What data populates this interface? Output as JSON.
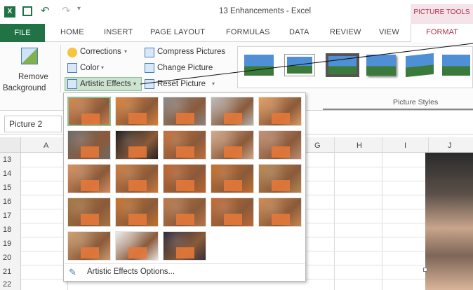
{
  "titlebar": {
    "title": "13 Enhancements - Excel",
    "context_group": "PICTURE TOOLS"
  },
  "tabs": {
    "file": "FILE",
    "items": [
      "HOME",
      "INSERT",
      "PAGE LAYOUT",
      "FORMULAS",
      "DATA",
      "REVIEW",
      "VIEW"
    ],
    "active": "FORMAT"
  },
  "ribbon": {
    "remove_background": [
      "Remove",
      "Background"
    ],
    "corrections": "Corrections",
    "color": "Color",
    "artistic_effects": "Artistic Effects",
    "compress_pictures": "Compress Pictures",
    "change_picture": "Change Picture",
    "reset_picture": "Reset Picture",
    "picture_styles_group": "Picture Styles"
  },
  "namebox": {
    "value": "Picture 2"
  },
  "columns": [
    "A",
    "G",
    "H",
    "I",
    "J"
  ],
  "rows": [
    "13",
    "14",
    "15",
    "16",
    "17",
    "18",
    "19",
    "20",
    "21",
    "22"
  ],
  "gallery": {
    "options_label": "Artistic Effects Options...",
    "rows": 5,
    "thumb_colors": [
      "#d8884e",
      "#e0843a",
      "#8a8a8a",
      "#bdbdbd",
      "#e7a060",
      "#6a6a6a",
      "#1c1c1c",
      "#c6713b",
      "#d6ab8c",
      "#c39276",
      "#d99260",
      "#cf7c3c",
      "#c2642e",
      "#c9702e",
      "#b98b52",
      "#a87740",
      "#c8742a",
      "#bc7a4a",
      "#c46a34",
      "#d08b50",
      "#cfa070",
      "#efefef",
      "#2b2b3a"
    ]
  },
  "colors": {
    "excel_green": "#217346",
    "accent_pink": "#b0324f"
  }
}
